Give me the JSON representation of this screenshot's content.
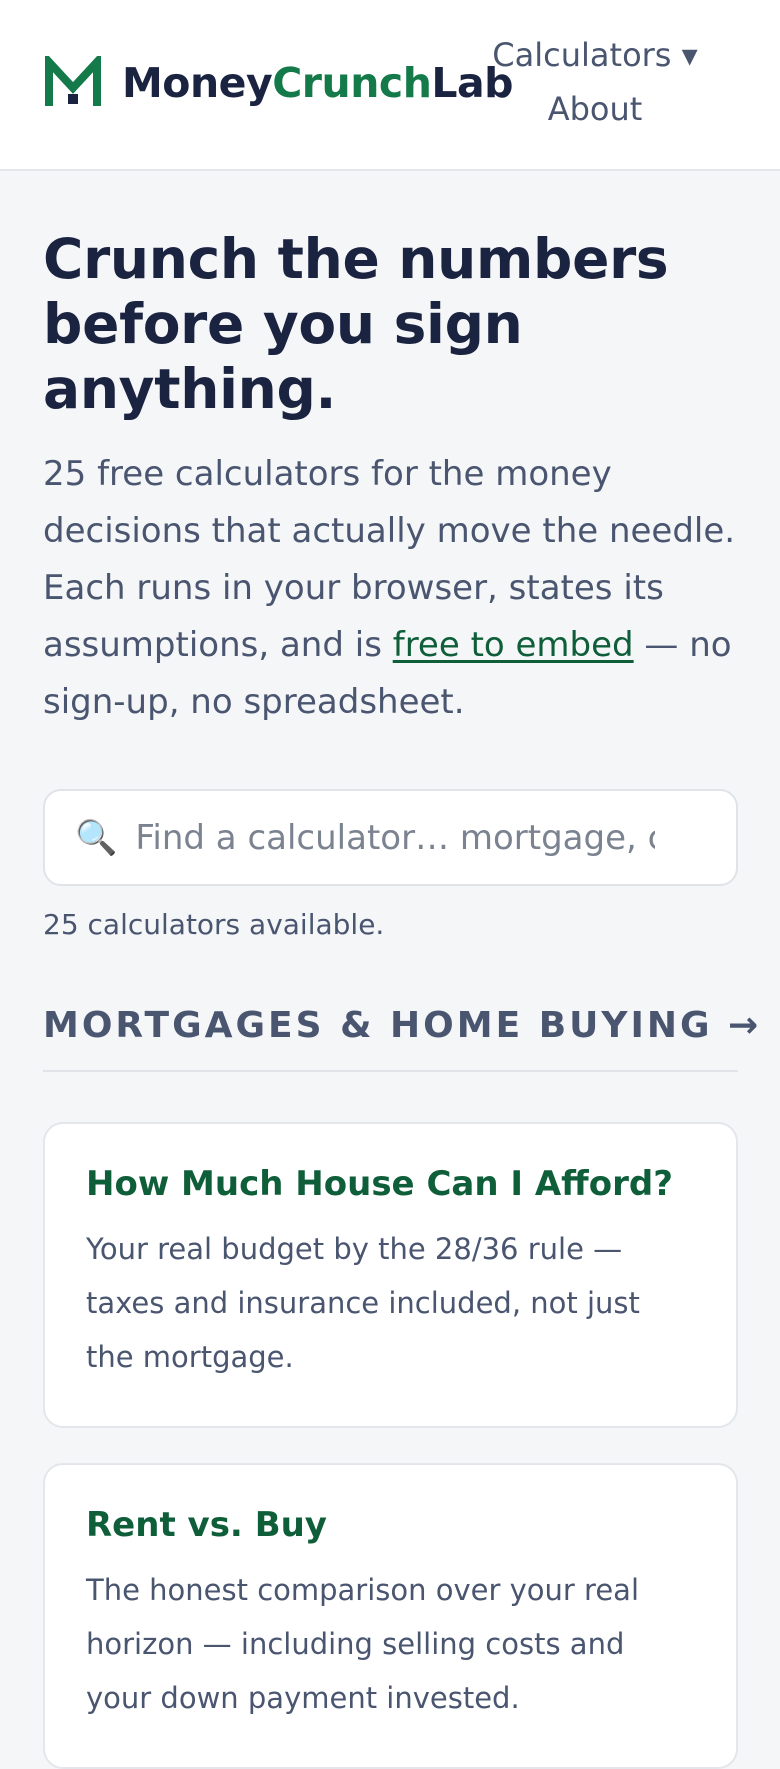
{
  "header": {
    "brand": {
      "part1": "Money",
      "part2": "Crunch",
      "part3": "Lab",
      "logo_icon": "m-logo-icon",
      "accent_color": "#157a4a"
    },
    "nav": {
      "calculators_label": "Calculators ▾",
      "about_label": "About"
    }
  },
  "hero": {
    "title": "Crunch the numbers before you sign anything.",
    "lede_before": "25 free calculators for the money decisions that actually move the needle. Each runs in your browser, states its assumptions, and is ",
    "lede_link": "free to embed",
    "lede_after": " — no sign-up, no spreadsheet."
  },
  "search": {
    "icon": "search-icon",
    "placeholder": "Find a calculator… mortgage, car, retirement",
    "value": ""
  },
  "count_text": "25 calculators available.",
  "section": {
    "title": "MORTGAGES & HOME BUYING →",
    "cards": [
      {
        "title": "How Much House Can I Afford?",
        "desc": "Your real budget by the 28/36 rule — taxes and insurance included, not just the mortgage."
      },
      {
        "title": "Rent vs. Buy",
        "desc": "The honest comparison over your real horizon — including selling costs and your down payment invested."
      }
    ]
  }
}
